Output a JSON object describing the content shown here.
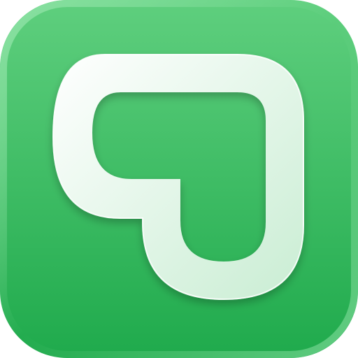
{
  "app_icon": {
    "icon_name": "heart-outline-icon",
    "colors": {
      "background_top": "#5fcf7e",
      "background_bottom": "#1faa4c",
      "rim_highlight": "#8fe3a6",
      "glyph_fill_top": "#ffffff",
      "glyph_fill_bottom": "#c9edd3",
      "glyph_edge": "#ffffff"
    }
  }
}
